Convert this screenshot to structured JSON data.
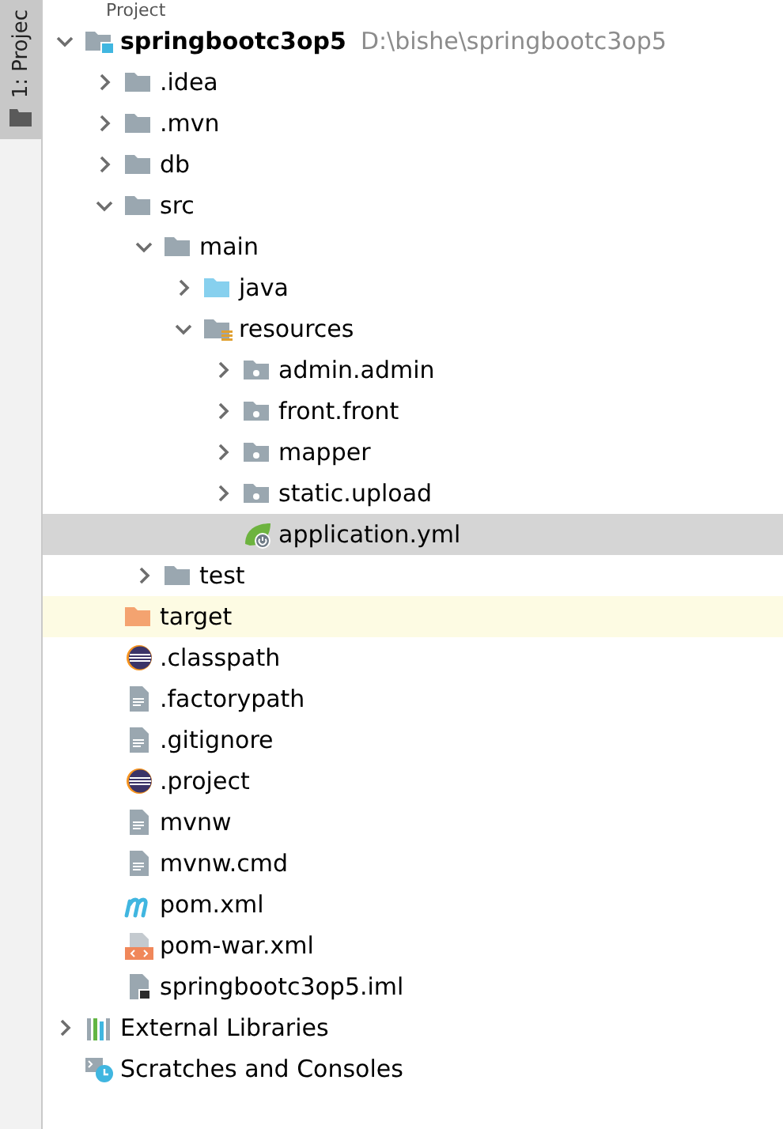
{
  "header": {
    "title": "Project"
  },
  "side_tab": {
    "label": "1: Projec",
    "selected": true
  },
  "tree": [
    {
      "label": "springbootc3op5",
      "path": "D:\\bishe\\springbootc3op5",
      "kind": "module",
      "expanded": true,
      "selected": false,
      "children": [
        {
          "label": ".idea",
          "kind": "folder",
          "expanded": false,
          "selected": false
        },
        {
          "label": ".mvn",
          "kind": "folder",
          "expanded": false,
          "selected": false
        },
        {
          "label": "db",
          "kind": "folder",
          "expanded": false,
          "selected": false
        },
        {
          "label": "src",
          "kind": "folder",
          "expanded": true,
          "selected": false,
          "children": [
            {
              "label": "main",
              "kind": "folder",
              "expanded": true,
              "selected": false,
              "children": [
                {
                  "label": "java",
                  "kind": "source",
                  "expanded": false,
                  "selected": false
                },
                {
                  "label": "resources",
                  "kind": "resources",
                  "expanded": true,
                  "selected": false,
                  "children": [
                    {
                      "label": "admin.admin",
                      "kind": "package",
                      "expanded": false,
                      "selected": false
                    },
                    {
                      "label": "front.front",
                      "kind": "package",
                      "expanded": false,
                      "selected": false
                    },
                    {
                      "label": "mapper",
                      "kind": "package",
                      "expanded": false,
                      "selected": false
                    },
                    {
                      "label": "static.upload",
                      "kind": "package",
                      "expanded": false,
                      "selected": false
                    },
                    {
                      "label": "application.yml",
                      "kind": "spring",
                      "selected": true
                    }
                  ]
                }
              ]
            },
            {
              "label": "test",
              "kind": "folder",
              "expanded": false,
              "selected": false
            }
          ]
        },
        {
          "label": "target",
          "kind": "excluded",
          "selected": false
        },
        {
          "label": ".classpath",
          "kind": "eclipse",
          "selected": false
        },
        {
          "label": ".factorypath",
          "kind": "text",
          "selected": false
        },
        {
          "label": ".gitignore",
          "kind": "text",
          "selected": false
        },
        {
          "label": ".project",
          "kind": "eclipse",
          "selected": false
        },
        {
          "label": "mvnw",
          "kind": "text",
          "selected": false
        },
        {
          "label": "mvnw.cmd",
          "kind": "text",
          "selected": false
        },
        {
          "label": "pom.xml",
          "kind": "maven",
          "selected": false
        },
        {
          "label": "pom-war.xml",
          "kind": "xml",
          "selected": false
        },
        {
          "label": "springbootc3op5.iml",
          "kind": "iml",
          "selected": false
        }
      ]
    },
    {
      "label": "External Libraries",
      "kind": "libraries",
      "expanded": false,
      "selected": false
    },
    {
      "label": "Scratches and Consoles",
      "kind": "scratches",
      "selected": false
    }
  ]
}
